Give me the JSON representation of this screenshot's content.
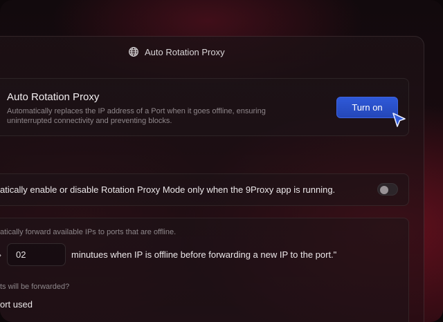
{
  "header": {
    "title": "Auto Rotation Proxy",
    "icon": "globe-icon"
  },
  "auto_rotation": {
    "title": "Auto Rotation Proxy",
    "description": "Automatically replaces the IP address of a Port when it goes offline, ensuring uninterrupted connectivity and preventing blocks.",
    "button_label": "Turn on",
    "button_color": "#2f59d8"
  },
  "app_running_setting": {
    "text": "atically enable or disable Rotation Proxy Mode only when the 9Proxy app is running.",
    "toggle_on": false
  },
  "forward_setting": {
    "description": "atically forward available IPs to ports that are offline.",
    "minutes_value": "02",
    "minutes_text": "minutues when IP is offline before forwarding a new IP to the port.\"",
    "question": "ts will be forwarded?",
    "option_label": "ort used"
  }
}
